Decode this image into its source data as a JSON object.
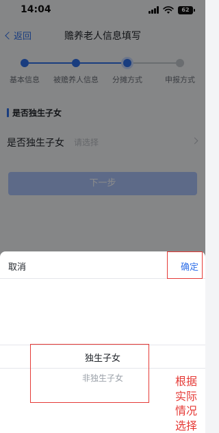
{
  "status_bar": {
    "time": "14:04",
    "battery": "62"
  },
  "nav": {
    "back_label": "返回",
    "title": "赡养老人信息填写"
  },
  "steps": [
    {
      "label": "基本信息",
      "state": "done"
    },
    {
      "label": "被赡养人信息",
      "state": "done"
    },
    {
      "label": "分摊方式",
      "state": "current"
    },
    {
      "label": "申报方式",
      "state": "future"
    }
  ],
  "form": {
    "section_title": "是否独生子女",
    "field_label": "是否独生子女",
    "field_placeholder": "请选择",
    "next_button": "下一步"
  },
  "picker": {
    "cancel_label": "取消",
    "confirm_label": "确定",
    "options": [
      {
        "label": "独生子女",
        "selected": true
      },
      {
        "label": "非独生子女",
        "selected": false
      }
    ]
  },
  "annotation": {
    "lines": [
      "根据",
      "实际",
      "情况",
      "选择"
    ]
  },
  "colors": {
    "accent": "#2f6fe8",
    "annotation_red": "#e53935",
    "inactive_step": "#c2c6cc"
  }
}
